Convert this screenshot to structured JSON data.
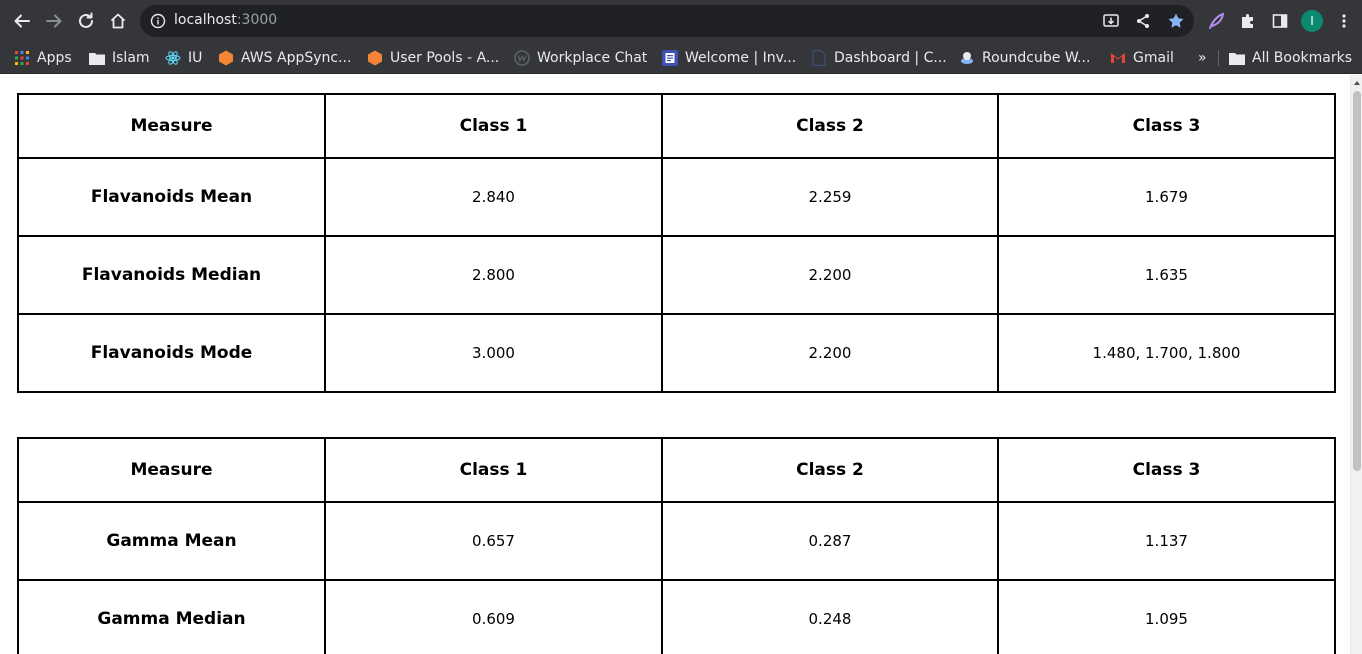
{
  "browser": {
    "url_host": "localhost",
    "url_port": ":3000",
    "profile_initial": "I",
    "bookmarks": [
      {
        "label": "Apps",
        "icon": "apps-grid-icon"
      },
      {
        "label": "Islam",
        "icon": "folder-icon"
      },
      {
        "label": "IU",
        "icon": "react-icon"
      },
      {
        "label": "AWS AppSync...",
        "icon": "aws-appsync-icon"
      },
      {
        "label": "User Pools - A...",
        "icon": "aws-cognito-icon"
      },
      {
        "label": "Workplace Chat",
        "icon": "workplace-icon"
      },
      {
        "label": "Welcome | Inv...",
        "icon": "invoice-icon"
      },
      {
        "label": "Dashboard | C...",
        "icon": "document-icon"
      },
      {
        "label": "Roundcube W...",
        "icon": "roundcube-icon"
      },
      {
        "label": "Gmail",
        "icon": "gmail-icon"
      }
    ],
    "overflow_label": "»",
    "all_bookmarks_label": "All Bookmarks"
  },
  "tables": [
    {
      "headers": [
        "Measure",
        "Class 1",
        "Class 2",
        "Class 3"
      ],
      "rows": [
        [
          "Flavanoids Mean",
          "2.840",
          "2.259",
          "1.679"
        ],
        [
          "Flavanoids Median",
          "2.800",
          "2.200",
          "1.635"
        ],
        [
          "Flavanoids Mode",
          "3.000",
          "2.200",
          "1.480, 1.700, 1.800"
        ]
      ]
    },
    {
      "headers": [
        "Measure",
        "Class 1",
        "Class 2",
        "Class 3"
      ],
      "rows": [
        [
          "Gamma Mean",
          "0.657",
          "0.287",
          "1.137"
        ],
        [
          "Gamma Median",
          "0.609",
          "0.248",
          "1.095"
        ]
      ]
    }
  ]
}
